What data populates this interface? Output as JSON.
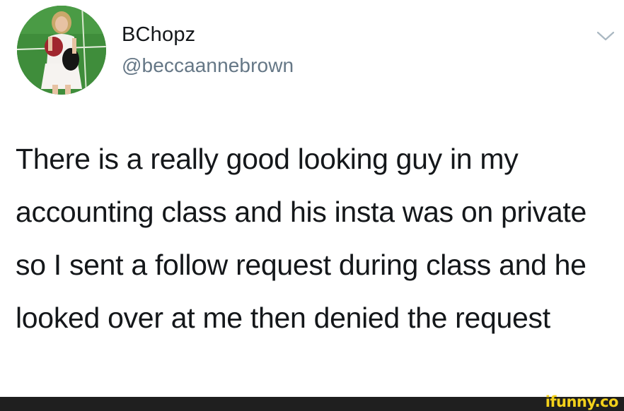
{
  "tweet": {
    "display_name": "BChopz",
    "handle": "@beccaannebrown",
    "text": "There is a really good looking guy in my accounting class and his insta was on private so I sent a follow request during class and he looked over at me then denied the request",
    "avatar_icon": "profile-photo-icon",
    "menu_icon": "chevron-down-icon"
  },
  "watermark": {
    "text": "ifunny.co"
  },
  "colors": {
    "text": "#14171a",
    "handle": "#657786",
    "chevron": "#aab8c2",
    "footer_bar": "#1f1f1f",
    "watermark": "#f3d11b"
  }
}
